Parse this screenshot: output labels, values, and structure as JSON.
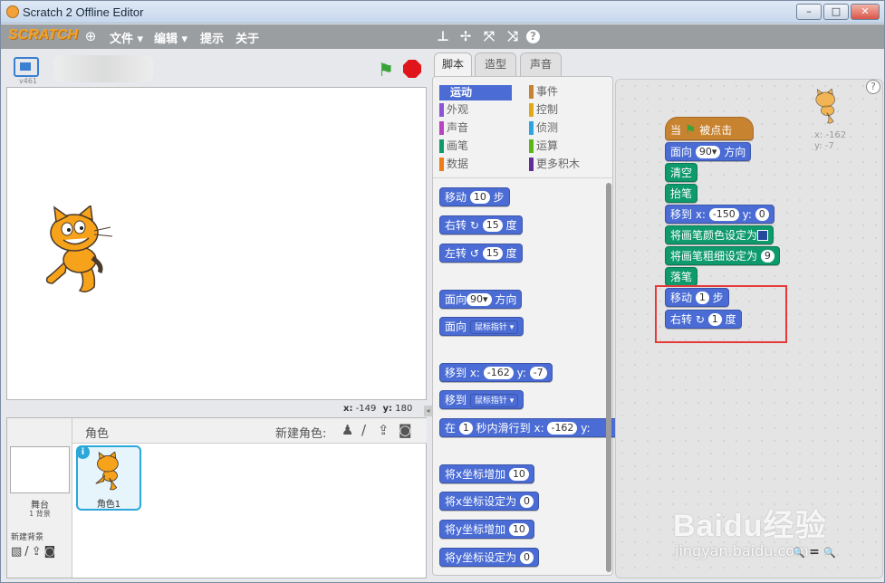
{
  "window": {
    "title": "Scratch 2 Offline Editor",
    "min_btn": "–",
    "max_btn": "□",
    "close_btn": "✕"
  },
  "menubar": {
    "logo": "SCRATCH",
    "items": [
      "文件 ▾",
      "编辑 ▾",
      "提示",
      "关于"
    ],
    "tool_icons": [
      "stamp-icon",
      "cut-icon",
      "grow-icon",
      "shrink-icon",
      "help-icon"
    ]
  },
  "stage": {
    "version": "v461",
    "mouse_x_label": "x:",
    "mouse_x": "-149",
    "mouse_y_label": "y:",
    "mouse_y": "180"
  },
  "sprites": {
    "header": "角色",
    "new_sprite": "新建角色:",
    "stage_label": "舞台",
    "backdrop_count": "1 背景",
    "new_backdrop": "新建背景",
    "sprite_name": "角色1"
  },
  "tabs": [
    "脚本",
    "造型",
    "声音"
  ],
  "categories": [
    {
      "label": "运动",
      "color": "#4a6cd4",
      "selected": true
    },
    {
      "label": "外观",
      "color": "#8a55d7"
    },
    {
      "label": "声音",
      "color": "#bb42c3"
    },
    {
      "label": "画笔",
      "color": "#0e9a6c"
    },
    {
      "label": "数据",
      "color": "#ee7d16"
    },
    {
      "label": "事件",
      "color": "#c88330"
    },
    {
      "label": "控制",
      "color": "#e1a91a"
    },
    {
      "label": "侦测",
      "color": "#2ca5e2"
    },
    {
      "label": "运算",
      "color": "#5cb712"
    },
    {
      "label": "更多积木",
      "color": "#632d99"
    }
  ],
  "palette_blocks": {
    "move": {
      "text": "移动",
      "n": "10",
      "unit": "步"
    },
    "turn_right": {
      "text": "右转",
      "n": "15",
      "unit": "度"
    },
    "turn_left": {
      "text": "左转",
      "n": "15",
      "unit": "度"
    },
    "point_dir": {
      "text": "面向",
      "n": "90▾",
      "unit": "方向"
    },
    "point_towards": {
      "text": "面向",
      "dd": "鼠标指针 ▾"
    },
    "goto_xy": {
      "text": "移到 x:",
      "x": "-162",
      "ylabel": "y:",
      "y": "-7"
    },
    "goto": {
      "text": "移到",
      "dd": "鼠标指针 ▾"
    },
    "glide": {
      "text": "在",
      "secs": "1",
      "mid": "秒内滑行到 x:",
      "x": "-162",
      "ylabel": "y:"
    },
    "change_x": {
      "text": "将x坐标增加",
      "n": "10"
    },
    "set_x": {
      "text": "将x坐标设定为",
      "n": "0"
    },
    "change_y": {
      "text": "将y坐标增加",
      "n": "10"
    },
    "set_y": {
      "text": "将y坐标设定为",
      "n": "0"
    }
  },
  "script": {
    "hat_pre": "当",
    "hat_post": "被点击",
    "point": {
      "text": "面向",
      "n": "90▾",
      "unit": "方向"
    },
    "clear": "清空",
    "pen_up": "抬笔",
    "goto": {
      "text": "移到 x:",
      "x": "-150",
      "ylabel": "y:",
      "y": "0"
    },
    "set_color": "将画笔颜色设定为",
    "set_size": {
      "text": "将画笔粗细设定为",
      "n": "9"
    },
    "pen_down": "落笔",
    "move": {
      "text": "移动",
      "n": "1",
      "unit": "步"
    },
    "turn": {
      "text": "右转",
      "n": "1",
      "unit": "度"
    }
  },
  "sprite_info": {
    "x": "x: -162",
    "y": "y: -7"
  },
  "watermark": {
    "brand": "Baidu经验",
    "url": "jingyan.baidu.com"
  },
  "zoom": {
    "out": "🔍",
    "reset": "=",
    "in": "🔍"
  },
  "help": "?",
  "colors": {
    "pen_swatch": "#244a9e",
    "highlight": "#e53a3a"
  }
}
